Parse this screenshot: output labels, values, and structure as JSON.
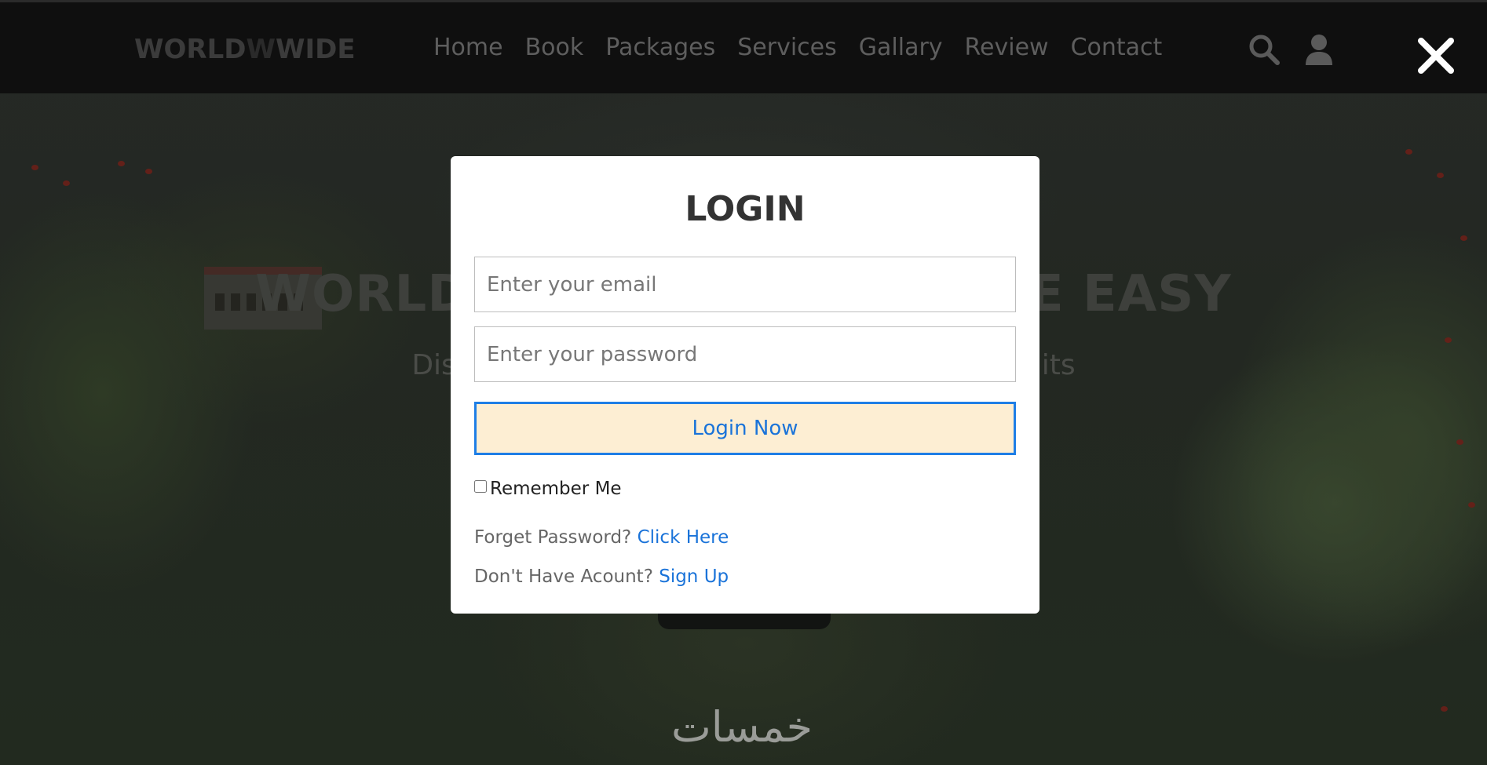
{
  "header": {
    "logo": {
      "part1": "WORLD",
      "mark": "W",
      "part2": "WIDE"
    },
    "nav": [
      "Home",
      "Book",
      "Packages",
      "Services",
      "Gallary",
      "Review",
      "Contact"
    ],
    "icons": [
      "search-icon",
      "user-icon"
    ]
  },
  "hero": {
    "title": "WORLD WIDE TRAVEL MADE EASY",
    "subtitle": "Discover new places with us, adventure awaits"
  },
  "watermark": "خمسات",
  "close_icon": "close-icon",
  "login": {
    "title": "LOGIN",
    "email_placeholder": "Enter your email",
    "password_placeholder": "Enter your password",
    "submit_label": "Login Now",
    "remember_label": "Remember Me",
    "remember_checked": false,
    "forgot_text": "Forget Password?",
    "forgot_link": "Click Here",
    "signup_text": "Don't Have Acount?",
    "signup_link": "Sign Up"
  },
  "colors": {
    "accent": "#1a73d9",
    "button_bg": "#fdeed3",
    "header_bg": "#0f0f0f",
    "modal_bg": "#ffffff"
  }
}
